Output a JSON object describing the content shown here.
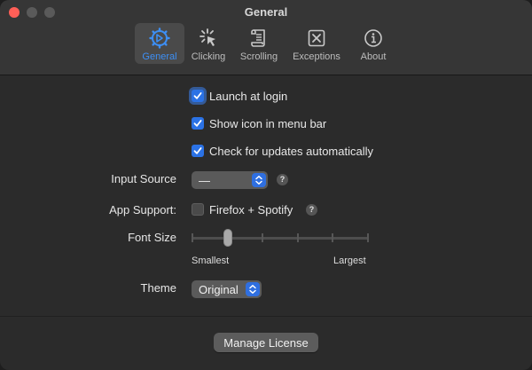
{
  "window": {
    "title": "General"
  },
  "tabs": [
    {
      "label": "General",
      "icon": "gear-icon",
      "active": true
    },
    {
      "label": "Clicking",
      "icon": "click-cursor-icon",
      "active": false
    },
    {
      "label": "Scrolling",
      "icon": "scroll-icon",
      "active": false
    },
    {
      "label": "Exceptions",
      "icon": "x-box-icon",
      "active": false
    },
    {
      "label": "About",
      "icon": "info-icon",
      "active": false
    }
  ],
  "settings": {
    "launch_at_login": {
      "label": "Launch at login",
      "checked": true
    },
    "show_icon": {
      "label": "Show icon in menu bar",
      "checked": true
    },
    "check_updates": {
      "label": "Check for updates automatically",
      "checked": true
    },
    "input_source": {
      "label": "Input Source",
      "value": "—",
      "help": "?"
    },
    "app_support": {
      "label": "App Support:",
      "option": "Firefox + Spotify",
      "checked": false,
      "help": "?"
    },
    "font_size": {
      "label": "Font Size",
      "min_label": "Smallest",
      "max_label": "Largest",
      "level": 2,
      "steps": 6
    },
    "theme": {
      "label": "Theme",
      "value": "Original"
    }
  },
  "footer": {
    "manage_license": "Manage License"
  },
  "colors": {
    "accent": "#2b72e5",
    "close": "#ff5f57"
  }
}
